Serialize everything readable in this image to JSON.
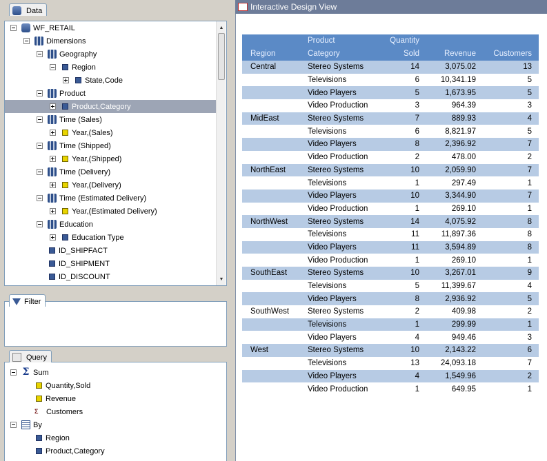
{
  "data_panel": {
    "tab_label": "Data",
    "tree": [
      {
        "label": "WF_RETAIL",
        "level": 0,
        "toggle": "minus",
        "icon": "database-icon"
      },
      {
        "label": "Dimensions",
        "level": 1,
        "toggle": "minus",
        "icon": "dimensions-icon"
      },
      {
        "label": "Geography",
        "level": 2,
        "toggle": "minus",
        "icon": "hierarchy-icon"
      },
      {
        "label": "Region",
        "level": 3,
        "toggle": "minus",
        "icon": "field-icon"
      },
      {
        "label": "State,Code",
        "level": 4,
        "toggle": "plus",
        "icon": "field-icon"
      },
      {
        "label": "Product",
        "level": 2,
        "toggle": "minus",
        "icon": "hierarchy-icon"
      },
      {
        "label": "Product,Category",
        "level": 3,
        "toggle": "plus",
        "icon": "field-icon",
        "selected": true
      },
      {
        "label": "Time (Sales)",
        "level": 2,
        "toggle": "minus",
        "icon": "hierarchy-icon"
      },
      {
        "label": "Year,(Sales)",
        "level": 3,
        "toggle": "plus",
        "icon": "date-field-icon"
      },
      {
        "label": "Time (Shipped)",
        "level": 2,
        "toggle": "minus",
        "icon": "hierarchy-icon"
      },
      {
        "label": "Year,(Shipped)",
        "level": 3,
        "toggle": "plus",
        "icon": "date-field-icon"
      },
      {
        "label": "Time (Delivery)",
        "level": 2,
        "toggle": "minus",
        "icon": "hierarchy-icon"
      },
      {
        "label": "Year,(Delivery)",
        "level": 3,
        "toggle": "plus",
        "icon": "date-field-icon"
      },
      {
        "label": "Time (Estimated Delivery)",
        "level": 2,
        "toggle": "minus",
        "icon": "hierarchy-icon"
      },
      {
        "label": "Year,(Estimated Delivery)",
        "level": 3,
        "toggle": "plus",
        "icon": "date-field-icon"
      },
      {
        "label": "Education",
        "level": 2,
        "toggle": "minus",
        "icon": "hierarchy-icon"
      },
      {
        "label": "Education Type",
        "level": 3,
        "toggle": "plus",
        "icon": "field-icon"
      },
      {
        "label": "ID_SHIPFACT",
        "level": 2,
        "toggle": "none",
        "icon": "field-icon"
      },
      {
        "label": "ID_SHIPMENT",
        "level": 2,
        "toggle": "none",
        "icon": "field-icon"
      },
      {
        "label": "ID_DISCOUNT",
        "level": 2,
        "toggle": "none",
        "icon": "field-icon"
      }
    ]
  },
  "filter_panel": {
    "tab_label": "Filter"
  },
  "query_panel": {
    "tab_label": "Query",
    "tree": [
      {
        "label": "Sum",
        "level": 0,
        "toggle": "minus",
        "icon": "sigma-icon"
      },
      {
        "label": "Quantity,Sold",
        "level": 1,
        "toggle": "none",
        "icon": "measure-icon"
      },
      {
        "label": "Revenue",
        "level": 1,
        "toggle": "none",
        "icon": "measure-icon"
      },
      {
        "label": "Customers",
        "level": 1,
        "toggle": "none",
        "icon": "count-icon"
      },
      {
        "label": "By",
        "level": 0,
        "toggle": "minus",
        "icon": "grid-icon"
      },
      {
        "label": "Region",
        "level": 1,
        "toggle": "none",
        "icon": "field-icon"
      },
      {
        "label": "Product,Category",
        "level": 1,
        "toggle": "none",
        "icon": "field-icon"
      }
    ]
  },
  "design_view": {
    "title": "Interactive Design View",
    "columns": [
      {
        "label1": "",
        "label2": "Region"
      },
      {
        "label1": "Product",
        "label2": "Category"
      },
      {
        "label1": "Quantity",
        "label2": "Sold"
      },
      {
        "label1": "",
        "label2": "Revenue"
      },
      {
        "label1": "",
        "label2": "Customers"
      }
    ],
    "rows": [
      [
        "Central",
        "Stereo Systems",
        "14",
        "3,075.02",
        "13"
      ],
      [
        "",
        "Televisions",
        "6",
        "10,341.19",
        "5"
      ],
      [
        "",
        "Video Players",
        "5",
        "1,673.95",
        "5"
      ],
      [
        "",
        "Video Production",
        "3",
        "964.39",
        "3"
      ],
      [
        "MidEast",
        "Stereo Systems",
        "7",
        "889.93",
        "4"
      ],
      [
        "",
        "Televisions",
        "6",
        "8,821.97",
        "5"
      ],
      [
        "",
        "Video Players",
        "8",
        "2,396.92",
        "7"
      ],
      [
        "",
        "Video Production",
        "2",
        "478.00",
        "2"
      ],
      [
        "NorthEast",
        "Stereo Systems",
        "10",
        "2,059.90",
        "7"
      ],
      [
        "",
        "Televisions",
        "1",
        "297.49",
        "1"
      ],
      [
        "",
        "Video Players",
        "10",
        "3,344.90",
        "7"
      ],
      [
        "",
        "Video Production",
        "1",
        "269.10",
        "1"
      ],
      [
        "NorthWest",
        "Stereo Systems",
        "14",
        "4,075.92",
        "8"
      ],
      [
        "",
        "Televisions",
        "11",
        "11,897.36",
        "8"
      ],
      [
        "",
        "Video Players",
        "11",
        "3,594.89",
        "8"
      ],
      [
        "",
        "Video Production",
        "1",
        "269.10",
        "1"
      ],
      [
        "SouthEast",
        "Stereo Systems",
        "10",
        "3,267.01",
        "9"
      ],
      [
        "",
        "Televisions",
        "5",
        "11,399.67",
        "4"
      ],
      [
        "",
        "Video Players",
        "8",
        "2,936.92",
        "5"
      ],
      [
        "SouthWest",
        "Stereo Systems",
        "2",
        "409.98",
        "2"
      ],
      [
        "",
        "Televisions",
        "1",
        "299.99",
        "1"
      ],
      [
        "",
        "Video Players",
        "4",
        "949.46",
        "3"
      ],
      [
        "West",
        "Stereo Systems",
        "10",
        "2,143.22",
        "6"
      ],
      [
        "",
        "Televisions",
        "13",
        "24,093.18",
        "7"
      ],
      [
        "",
        "Video Players",
        "4",
        "1,549.96",
        "2"
      ],
      [
        "",
        "Video Production",
        "1",
        "649.95",
        "1"
      ]
    ]
  }
}
